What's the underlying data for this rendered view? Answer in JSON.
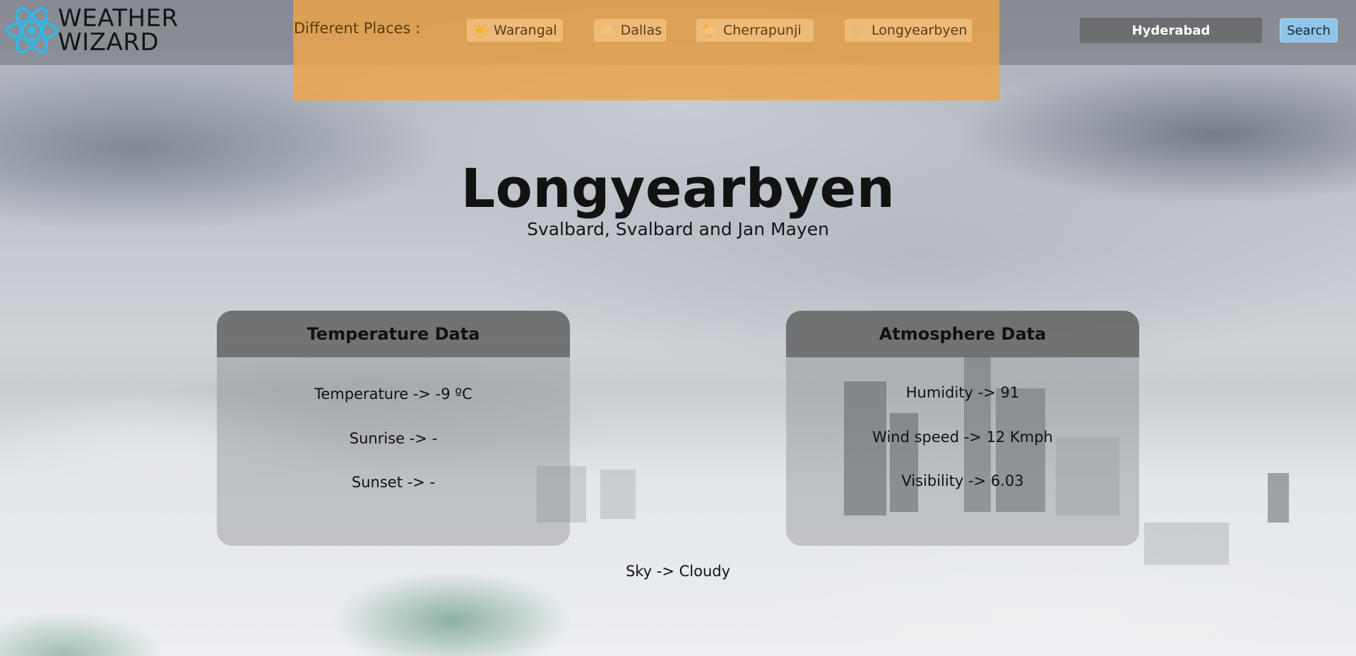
{
  "app": {
    "logo_line1": "WEATHER",
    "logo_line2": "WIZARD"
  },
  "places": {
    "label": "Different Places :",
    "items": [
      {
        "label": "Warangal",
        "icon": "sun-icon"
      },
      {
        "label": "Dallas",
        "icon": "cloud-icon"
      },
      {
        "label": "Cherrapunji",
        "icon": "rain-cloud-icon"
      },
      {
        "label": "Longyearbyen",
        "icon": "snow-icon"
      }
    ]
  },
  "search": {
    "value": "Hyderabad",
    "button_label": "Search"
  },
  "location": {
    "city": "Longyearbyen",
    "region": "Svalbard, Svalbard and Jan Mayen"
  },
  "temperature_card": {
    "title": "Temperature Data",
    "temperature": "Temperature -> -9 ºC",
    "sunrise": "Sunrise -> -",
    "sunset": "Sunset -> -"
  },
  "atmosphere_card": {
    "title": "Atmosphere Data",
    "humidity": "Humidity -> 91",
    "wind_speed": "Wind speed -> 12 Kmph",
    "visibility": "Visibility -> 6.03"
  },
  "sky": "Sky -> Cloudy",
  "colors": {
    "header_overlay": "#6e7074",
    "places_panel": "#eea548",
    "search_input_bg": "#6c6d6f",
    "search_button_bg": "#8fc4ea",
    "logo_icon": "#2fb8e8"
  }
}
